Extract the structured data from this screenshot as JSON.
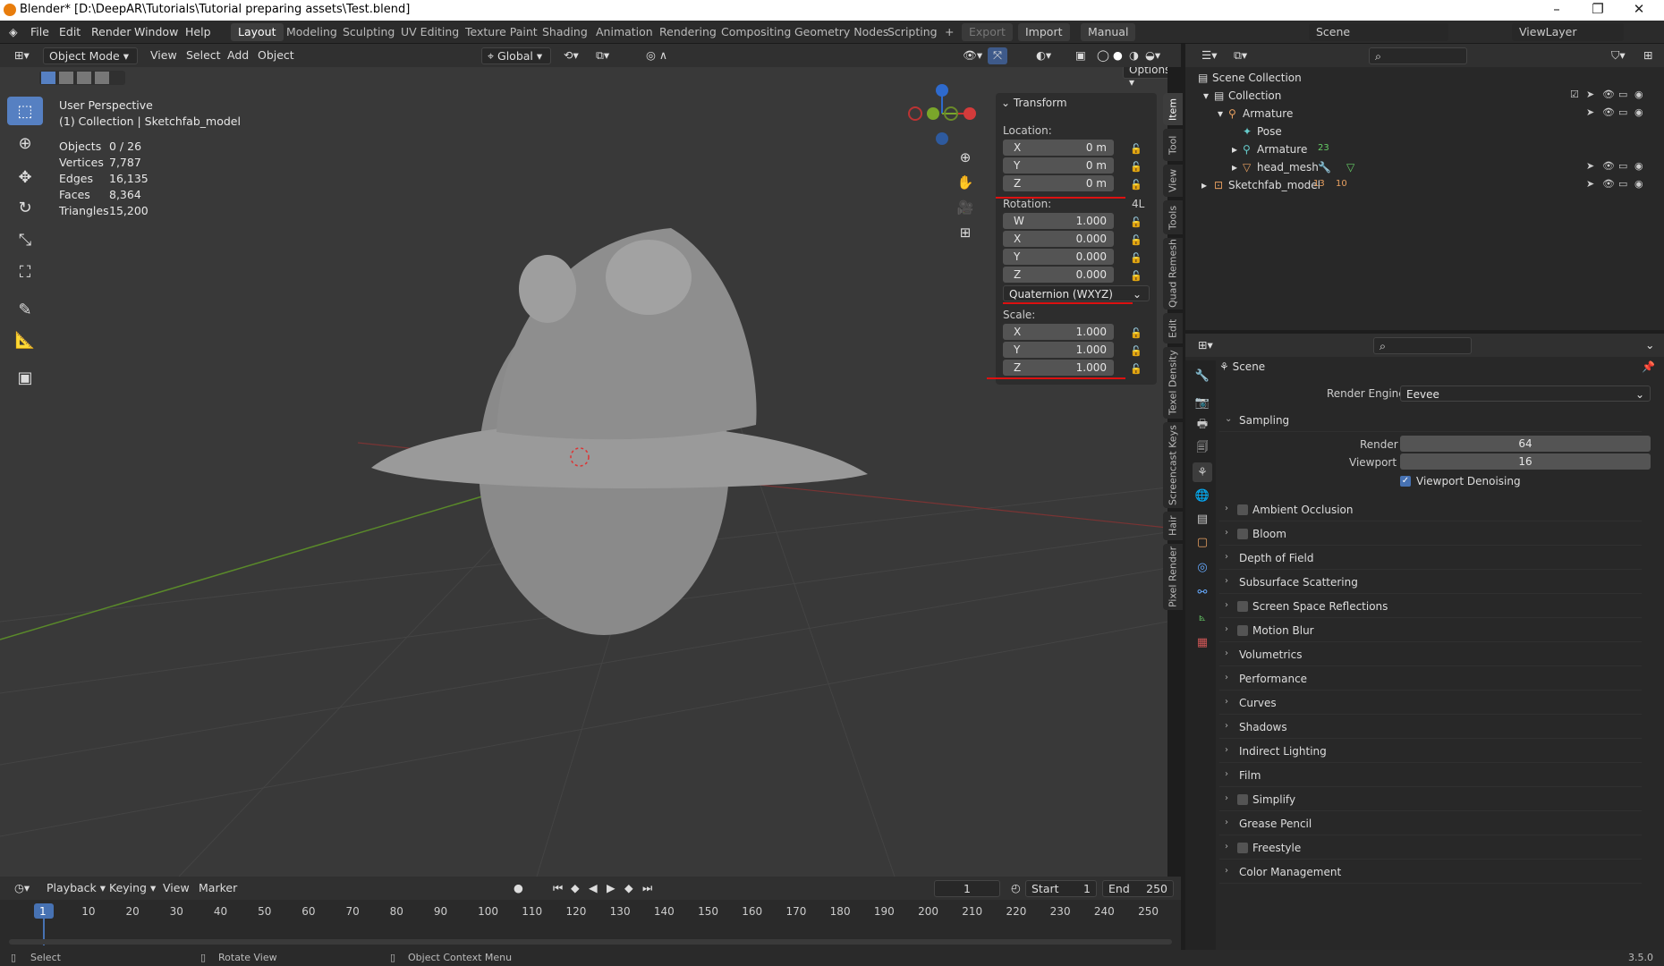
{
  "titlebar": {
    "title": "Blender* [D:\\DeepAR\\Tutorials\\Tutorial preparing assets\\Test.blend]"
  },
  "menu": [
    "File",
    "Edit",
    "Render",
    "Window",
    "Help"
  ],
  "workspaces": [
    "Layout",
    "Modeling",
    "Sculpting",
    "UV Editing",
    "Texture Paint",
    "Shading",
    "Animation",
    "Rendering",
    "Compositing",
    "Geometry Nodes",
    "Scripting"
  ],
  "topright": {
    "export": "Export",
    "import": "Import",
    "manual": "Manual",
    "scene": "Scene",
    "viewlayer": "ViewLayer"
  },
  "viewport_header": {
    "mode": "Object Mode",
    "view": "View",
    "select": "Select",
    "add": "Add",
    "object": "Object",
    "orientation": "Global",
    "options": "Options"
  },
  "overlay": {
    "view_name": "User Perspective",
    "collection": "(1) Collection | Sketchfab_model",
    "stats": [
      {
        "label": "Objects",
        "value": "0 / 26"
      },
      {
        "label": "Vertices",
        "value": "7,787"
      },
      {
        "label": "Edges",
        "value": "16,135"
      },
      {
        "label": "Faces",
        "value": "8,364"
      },
      {
        "label": "Triangles",
        "value": "15,200"
      }
    ]
  },
  "transform": {
    "title": "Transform",
    "location_label": "Location:",
    "location": [
      {
        "axis": "X",
        "value": "0 m"
      },
      {
        "axis": "Y",
        "value": "0 m"
      },
      {
        "axis": "Z",
        "value": "0 m"
      }
    ],
    "rotation_label": "Rotation:",
    "rotation_mode_short": "4L",
    "rotation": [
      {
        "axis": "W",
        "value": "1.000"
      },
      {
        "axis": "X",
        "value": "0.000"
      },
      {
        "axis": "Y",
        "value": "0.000"
      },
      {
        "axis": "Z",
        "value": "0.000"
      }
    ],
    "rotation_mode": "Quaternion (WXYZ)",
    "scale_label": "Scale:",
    "scale": [
      {
        "axis": "X",
        "value": "1.000"
      },
      {
        "axis": "Y",
        "value": "1.000"
      },
      {
        "axis": "Z",
        "value": "1.000"
      }
    ]
  },
  "side_tabs": [
    "Item",
    "Tool",
    "View",
    "Tools",
    "Quad Remesh",
    "Edit",
    "Texel Density",
    "Screencast Keys",
    "Hair",
    "Pixel Render"
  ],
  "outliner": {
    "rows": [
      {
        "label": "Scene Collection"
      },
      {
        "label": "Collection"
      },
      {
        "label": "Armature"
      },
      {
        "label": "Pose"
      },
      {
        "label": "Armature",
        "badge": "23"
      },
      {
        "label": "head_mesh"
      },
      {
        "label": "Sketchfab_model",
        "badge": "13",
        "badge2": "10"
      }
    ]
  },
  "properties": {
    "context": "Scene",
    "render_engine_label": "Render Engine",
    "render_engine": "Eevee",
    "sampling": "Sampling",
    "render_label": "Render",
    "render_value": "64",
    "viewport_label": "Viewport",
    "viewport_value": "16",
    "denoise": "Viewport Denoising",
    "panels": [
      {
        "label": "Ambient Occlusion",
        "check": true
      },
      {
        "label": "Bloom",
        "check": true
      },
      {
        "label": "Depth of Field",
        "check": false
      },
      {
        "label": "Subsurface Scattering",
        "check": false
      },
      {
        "label": "Screen Space Reflections",
        "check": true
      },
      {
        "label": "Motion Blur",
        "check": true
      },
      {
        "label": "Volumetrics",
        "check": false
      },
      {
        "label": "Performance",
        "check": false
      },
      {
        "label": "Curves",
        "check": false
      },
      {
        "label": "Shadows",
        "check": false
      },
      {
        "label": "Indirect Lighting",
        "check": false
      },
      {
        "label": "Film",
        "check": false
      },
      {
        "label": "Simplify",
        "check": true
      },
      {
        "label": "Grease Pencil",
        "check": false
      },
      {
        "label": "Freestyle",
        "check": true
      },
      {
        "label": "Color Management",
        "check": false
      }
    ]
  },
  "timeline": {
    "playback": "Playback",
    "keying": "Keying",
    "view": "View",
    "marker": "Marker",
    "current": "1",
    "start_label": "Start",
    "start": "1",
    "end_label": "End",
    "end": "250",
    "ticks": [
      "1",
      "10",
      "20",
      "30",
      "40",
      "50",
      "60",
      "70",
      "80",
      "90",
      "100",
      "110",
      "120",
      "130",
      "140",
      "150",
      "160",
      "170",
      "180",
      "190",
      "200",
      "210",
      "220",
      "230",
      "240",
      "250"
    ]
  },
  "statusbar": {
    "select": "Select",
    "rotate": "Rotate View",
    "context": "Object Context Menu",
    "version": "3.5.0"
  }
}
